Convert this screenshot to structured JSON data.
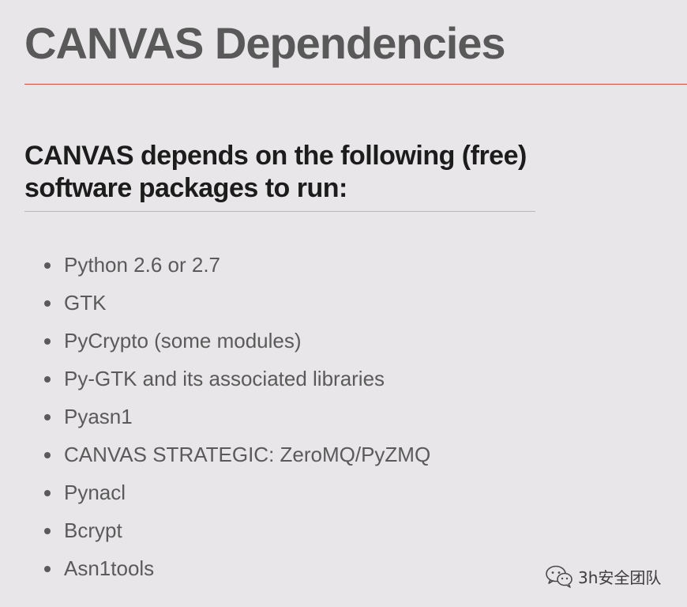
{
  "title": "CANVAS Dependencies",
  "heading": "CANVAS depends on the following (free) software packages to run:",
  "packages": [
    "Python 2.6 or 2.7",
    "GTK",
    "PyCrypto (some modules)",
    "Py-GTK and its associated libraries",
    "Pyasn1",
    "CANVAS STRATEGIC: ZeroMQ/PyZMQ",
    "Pynacl",
    "Bcrypt",
    "Asn1tools"
  ],
  "watermark": {
    "text": "3h安全团队",
    "icon": "wechat-icon"
  },
  "colors": {
    "background": "#e8e6e8",
    "title_rule": "#c44f4a",
    "text": "#5a5a5a"
  }
}
